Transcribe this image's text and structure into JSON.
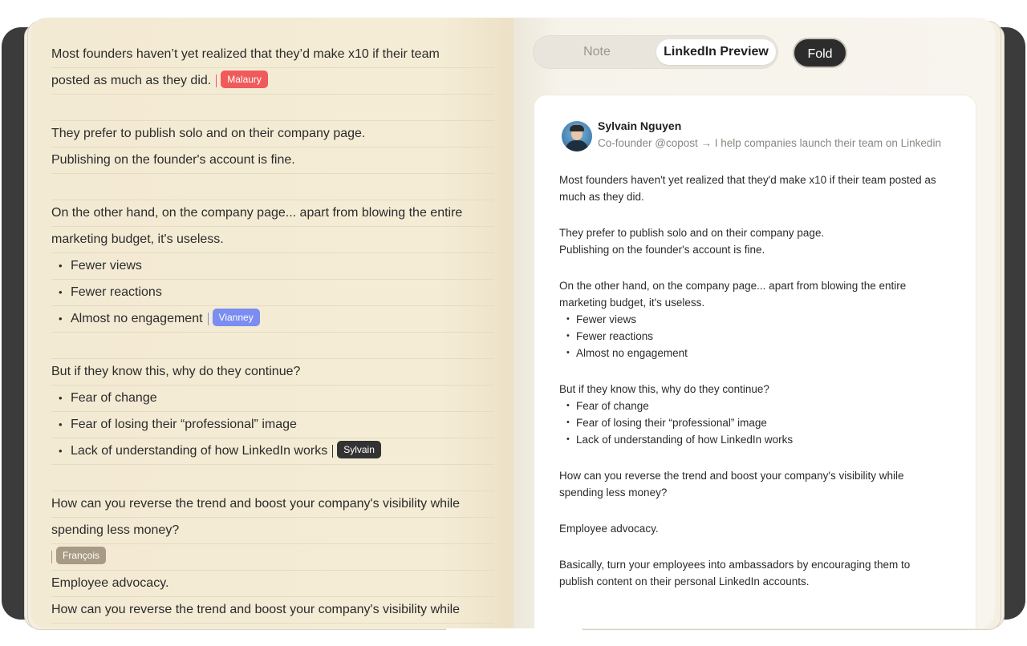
{
  "note_editor": {
    "lines": [
      {
        "text": "Most founders haven’t yet realized that they’d make x10 if their team",
        "bullet": false
      },
      {
        "text": "posted as much as they did.",
        "bullet": false,
        "tag": {
          "label": "Malaury",
          "color": "#ef5a5a"
        }
      },
      {
        "text": "",
        "bullet": false
      },
      {
        "text": "They prefer to publish solo and on their company page.",
        "bullet": false
      },
      {
        "text": "Publishing on the founder's account is fine.",
        "bullet": false
      },
      {
        "text": "",
        "bullet": false
      },
      {
        "text": "On the other hand, on the company page... apart from blowing the entire",
        "bullet": false
      },
      {
        "text": "marketing budget, it's useless.",
        "bullet": false
      },
      {
        "text": "Fewer views",
        "bullet": true
      },
      {
        "text": "Fewer reactions",
        "bullet": true
      },
      {
        "text": "Almost no engagement",
        "bullet": true,
        "tag": {
          "label": "Vianney",
          "color": "#7b8df0"
        }
      },
      {
        "text": "",
        "bullet": false
      },
      {
        "text": "But if they know this, why do they continue?",
        "bullet": false
      },
      {
        "text": "Fear of change",
        "bullet": true
      },
      {
        "text": "Fear of losing their “professional” image",
        "bullet": true
      },
      {
        "text": "Lack of understanding of how LinkedIn works",
        "bullet": true,
        "tag": {
          "label": "Sylvain",
          "color": "#333333"
        }
      },
      {
        "text": "",
        "bullet": false
      },
      {
        "text": "How can you reverse the trend and boost your company's visibility while",
        "bullet": false
      },
      {
        "text": "spending less money?",
        "bullet": false
      },
      {
        "text": "",
        "bullet": false,
        "tag": {
          "label": "François",
          "color": "#a89a84"
        }
      },
      {
        "text": "Employee advocacy.",
        "bullet": false
      },
      {
        "text": "How can you reverse the trend and boost your company's visibility while",
        "bullet": false
      }
    ]
  },
  "toolbar": {
    "note_label": "Note",
    "preview_label": "LinkedIn Preview",
    "fold_label": "Fold"
  },
  "preview": {
    "author_name": "Sylvain Nguyen",
    "author_bio": "Co-founder @copost → I help companies launch their team on Linkedin",
    "blocks": [
      {
        "lines": [
          "Most founders haven't yet realized that they'd make x10 if their team posted as",
          "much as they did."
        ]
      },
      {
        "lines": [
          "They prefer to publish solo and on their company page.",
          "Publishing on the founder's account is fine."
        ]
      },
      {
        "lines": [
          "On the other hand, on the company page... apart from blowing the entire",
          "marketing budget, it's useless."
        ],
        "bullets": [
          "Fewer views",
          "Fewer reactions",
          "Almost no engagement"
        ]
      },
      {
        "lines": [
          "But if they know this, why do they continue?"
        ],
        "bullets": [
          "Fear of change",
          "Fear of losing their “professional” image",
          "Lack of understanding of how LinkedIn works"
        ]
      },
      {
        "lines": [
          "How can you reverse the trend and boost your company's visibility while",
          "spending less money?"
        ]
      },
      {
        "lines": [
          "Employee advocacy."
        ]
      },
      {
        "lines": [
          "Basically, turn your employees into ambassadors by encouraging them to",
          "publish content on their personal LinkedIn accounts."
        ]
      }
    ]
  }
}
